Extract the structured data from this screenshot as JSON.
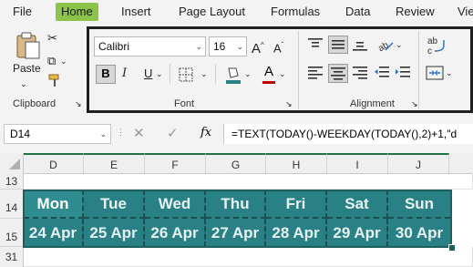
{
  "menu": {
    "tabs": [
      "File",
      "Home",
      "Insert",
      "Page Layout",
      "Formulas",
      "Data",
      "Review",
      "View"
    ],
    "active": "Home"
  },
  "ribbon": {
    "clipboard": {
      "paste_label": "Paste",
      "group_label": "Clipboard"
    },
    "font": {
      "font_name": "Calibri",
      "font_size": "16",
      "bold": "B",
      "italic": "I",
      "underline": "U",
      "group_label": "Font"
    },
    "alignment": {
      "group_label": "Alignment"
    }
  },
  "formula_bar": {
    "name_box": "D14",
    "fx": "fx",
    "formula": "=TEXT(TODAY()-WEEKDAY(TODAY(),2)+1,\"d"
  },
  "grid": {
    "columns": [
      "D",
      "E",
      "F",
      "G",
      "H",
      "I",
      "J"
    ],
    "rows": [
      "13",
      "14",
      "15",
      "31"
    ],
    "days": [
      "Mon",
      "Tue",
      "Wed",
      "Thu",
      "Fri",
      "Sat",
      "Sun"
    ],
    "dates": [
      "24 Apr",
      "25 Apr",
      "26 Apr",
      "27 Apr",
      "28 Apr",
      "29 Apr",
      "30 Apr"
    ]
  },
  "colors": {
    "accent": "#217346",
    "home_tab": "#8cc34a",
    "cell_fill": "#2a8185",
    "cell_border": "#1b4f51"
  }
}
